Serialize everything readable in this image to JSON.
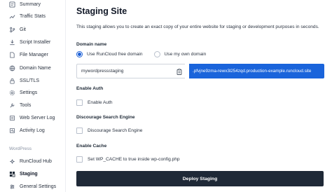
{
  "sidebar": {
    "items": [
      {
        "label": "Summary",
        "icon": "summary-icon"
      },
      {
        "label": "Traffic Stats",
        "icon": "traffic-stats-icon"
      },
      {
        "label": "Git",
        "icon": "git-icon"
      },
      {
        "label": "Script Installer",
        "icon": "script-installer-icon"
      },
      {
        "label": "File Manager",
        "icon": "file-manager-icon"
      },
      {
        "label": "Domain Name",
        "icon": "globe-icon"
      },
      {
        "label": "SSL/TLS",
        "icon": "lock-icon"
      },
      {
        "label": "Settings",
        "icon": "gear-icon"
      },
      {
        "label": "Tools",
        "icon": "tools-icon"
      },
      {
        "label": "Web Server Log",
        "icon": "log-icon"
      },
      {
        "label": "Activity Log",
        "icon": "activity-log-icon"
      }
    ],
    "section_label": "WordPress",
    "wp_items": [
      {
        "label": "RunCloud Hub",
        "icon": "hub-icon"
      },
      {
        "label": "Staging",
        "icon": "staging-icon",
        "active": true
      },
      {
        "label": "General Settings",
        "icon": "settings-icon"
      }
    ]
  },
  "main": {
    "title": "Staging Site",
    "description": "This staging allows you to create an exact copy of your entire website for staging or development purposes in seconds.",
    "domain_name_label": "Domain name",
    "radio_options": [
      {
        "label": "Use RunCloud free domain",
        "checked": true
      },
      {
        "label": "Use my own domain",
        "checked": false
      }
    ],
    "domain_value": "mywordpressstaging",
    "domain_suffix": ".pfvjne9zma-rewx3l254zqd.production-example.runcloud.site",
    "enable_auth_label": "Enable Auth",
    "enable_auth_checkbox": "Enable Auth",
    "search_engine_label": "Discourage Search Engine",
    "search_engine_checkbox": "Discourage Search Engine",
    "cache_label": "Enable Cache",
    "cache_checkbox": "Set WP_CACHE to true inside wp-config.php",
    "deploy_button": "Deploy Staging"
  },
  "colors": {
    "accent": "#1a64db",
    "button_dark": "#1f2937"
  }
}
